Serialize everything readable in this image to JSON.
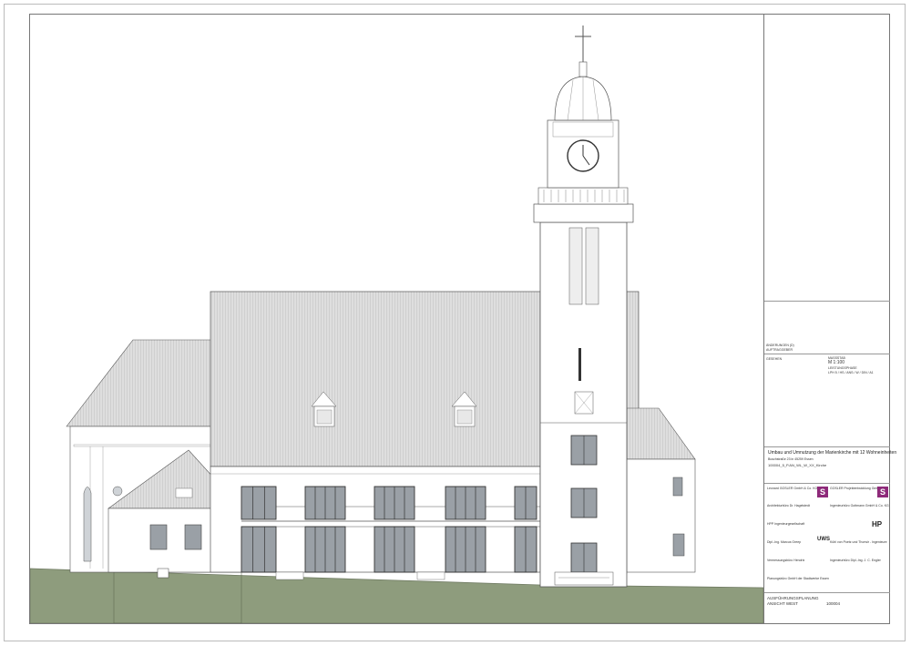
{
  "colors": {
    "ground": "#8e9c7d",
    "line": "#555555",
    "roof": "#dedede",
    "wall": "#ffffff",
    "glass": "#9aa0a6",
    "logo": "#8e2a7a"
  },
  "title_block": {
    "rev_label": "ÄNDERUNGEN (D)",
    "rev_sub": "AUFTRAGGEBER",
    "stamp_small": "GESEHEN",
    "scale_caption": "MASSSTAB",
    "scale_value": "M 1:100",
    "stage_caption": "LEISTUNGSPHASE",
    "plan_code": "LPH 5  /  HS  /  ANS  /  W  /  DIN  /  A1",
    "project_title": "Umbau und Umnutzung der Marienkirche mit 12 Wohneinheiten",
    "project_address": "Buschstraße 23 in 45259 Essen",
    "drawing_id": "100004_5_P.AN_WL_W_XX_Kirche",
    "client": "Leonard GOSLER GmbH & Co. KG",
    "client_logo": "S",
    "developer": "GOSLER Projektentwicklung GmbH",
    "developer_logo": "S",
    "architect": "Architekturbüro Dr. Hagelstedt",
    "engineer": "Ingenieurbüro Gottmann GmbH & Co. KG",
    "planning_office": "HPP Ingenieurgesellschaft",
    "planning_logo": "HP",
    "structural": "Dipl.-Ing. Marcus Greep",
    "partner_logo": "UWS",
    "fire": "Kühl von Poetz und Thorwir - Ingenieure",
    "survey": "Vermessungsbüro Hendrix",
    "energy": "Ingenieurbüro Dipl.-Ing. J. C. Engler",
    "surveyor": "Planungsbüro GmbH der Stadtwerke Essen",
    "phase": "AUSFÜHRUNGSPLANUNG",
    "view": "ANSICHT WEST",
    "plan_number": "100004"
  }
}
